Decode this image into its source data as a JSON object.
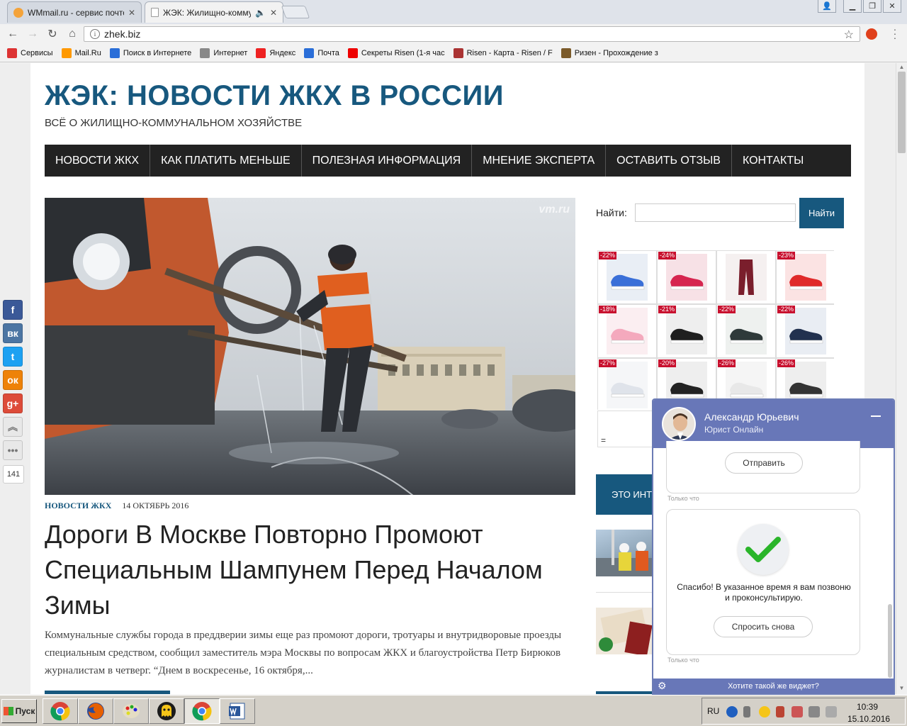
{
  "browser": {
    "tabs": [
      {
        "title": "WMmail.ru - сервис почтов",
        "active": false
      },
      {
        "title": "ЖЭК: Жилищно-коммуна",
        "active": true
      }
    ],
    "url": "zhek.biz",
    "bookmarks": [
      {
        "label": "Сервисы",
        "icon": "apps-grid-icon",
        "color": "#d33"
      },
      {
        "label": "Mail.Ru",
        "icon": "mailru-icon",
        "color": "#f90"
      },
      {
        "label": "Поиск в Интернете",
        "icon": "search-icon",
        "color": "#2a6ed8"
      },
      {
        "label": "Интернет",
        "icon": "page-icon",
        "color": "#888"
      },
      {
        "label": "Яндекс",
        "icon": "yandex-icon",
        "color": "#e22"
      },
      {
        "label": "Почта",
        "icon": "mail-icon",
        "color": "#2a6ed8"
      },
      {
        "label": "Секреты Risen (1-я час",
        "icon": "youtube-icon",
        "color": "#e00"
      },
      {
        "label": "Risen - Карта - Risen / F",
        "icon": "rpg-icon",
        "color": "#a33"
      },
      {
        "label": "Ризен - Прохождение з",
        "icon": "w-icon",
        "color": "#7a5a2a"
      }
    ]
  },
  "site": {
    "title": "ЖЭК: НОВОСТИ ЖКХ В РОССИИ",
    "tagline": "ВСЁ О ЖИЛИЩНО-КОММУНАЛЬНОМ ХОЗЯЙСТВЕ",
    "nav": [
      "НОВОСТИ ЖКХ",
      "КАК ПЛАТИТЬ МЕНЬШЕ",
      "ПОЛЕЗНАЯ ИНФОРМАЦИЯ",
      "МНЕНИЕ ЭКСПЕРТА",
      "ОСТАВИТЬ ОТЗЫВ",
      "КОНТАКТЫ"
    ],
    "colors": {
      "brand": "#17587e",
      "nav_bg": "#222222"
    }
  },
  "post": {
    "image_watermark": "vm.ru",
    "category": "НОВОСТИ ЖКХ",
    "date": "14 ОКТЯБРЬ 2016",
    "title": "Дороги В Москве Повторно Промоют Специальным Шампунем Перед Началом Зимы",
    "excerpt": "Коммунальные службы города в преддверии зимы еще раз промоют дороги, тротуары и внутридворовые проезды специальным средством, сообщил заместитель мэра Москвы по вопросам ЖКХ и благоустройства Петр Бирюков журналистам в четверг. “Днем в воскресенье, 16 октября,..."
  },
  "sidebar": {
    "search_label": "Найти:",
    "search_value": "",
    "search_button": "Найти",
    "shop_items": [
      {
        "badge": "-22%",
        "color": "#e9eef5",
        "accent": "#3a6fd8"
      },
      {
        "badge": "-24%",
        "color": "#f7e1e6",
        "accent": "#d6254f"
      },
      {
        "badge": "",
        "color": "#f5f0f0",
        "accent": "#7a1e2c"
      },
      {
        "badge": "-23%",
        "color": "#fbe3e3",
        "accent": "#e02a2a"
      },
      {
        "badge": "-18%",
        "color": "#fbeef1",
        "accent": "#f4a9bd"
      },
      {
        "badge": "-21%",
        "color": "#eeeeee",
        "accent": "#1f1f1f"
      },
      {
        "badge": "-22%",
        "color": "#eef1ef",
        "accent": "#2f3a3a"
      },
      {
        "badge": "-22%",
        "color": "#e9edf3",
        "accent": "#22314f"
      },
      {
        "badge": "-27%",
        "color": "#f5f6f8",
        "accent": "#dfe3ea"
      },
      {
        "badge": "-20%",
        "color": "#eeeeee",
        "accent": "#222222"
      },
      {
        "badge": "-26%",
        "color": "#f5f5f5",
        "accent": "#e8e8e8"
      },
      {
        "badge": "-26%",
        "color": "#eeeeee",
        "accent": "#333333"
      }
    ],
    "shop_box_text": "=",
    "promo_text": "ЭТО ИНТ"
  },
  "share": {
    "buttons": [
      {
        "name": "facebook",
        "glyph": "f",
        "color": "#3b5998"
      },
      {
        "name": "vkontakte",
        "glyph": "вк",
        "color": "#4c75a3"
      },
      {
        "name": "twitter",
        "glyph": "t",
        "color": "#1da1f2"
      },
      {
        "name": "odnoklassniki",
        "glyph": "ок",
        "color": "#ee8208"
      },
      {
        "name": "google-plus",
        "glyph": "g+",
        "color": "#dd4b39"
      },
      {
        "name": "scroll-up",
        "glyph": "︽",
        "color": "#e8e8e8"
      },
      {
        "name": "more",
        "glyph": "•••",
        "color": "#e8e8e8"
      }
    ],
    "count": "141"
  },
  "chat": {
    "agent_name": "Александр Юрьевич",
    "agent_role": "Юрист Онлайн",
    "send_button": "Отправить",
    "timestamp1": "Только что",
    "thanks_text": "Спасибо! В указанное время я вам позвоню и проконсультирую.",
    "ask_again_button": "Спросить снова",
    "timestamp2": "Только что",
    "footer_text": "Хотите такой же виджет?",
    "colors": {
      "header": "#6877b8",
      "check": "#2ab52a"
    }
  },
  "taskbar": {
    "start_label": "Пуск",
    "lang": "RU",
    "time": "10:39",
    "date": "15.10.2016"
  }
}
